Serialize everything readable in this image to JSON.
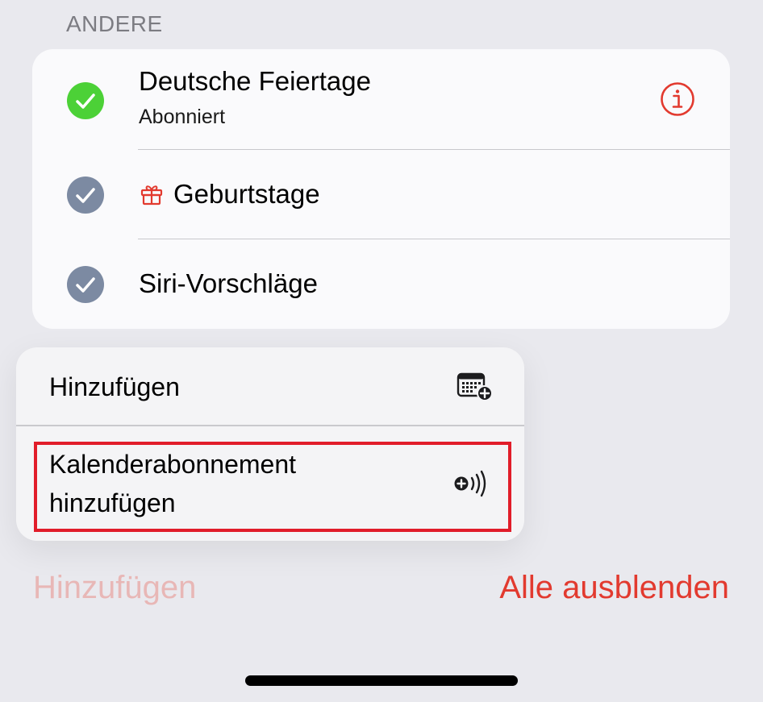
{
  "section": {
    "header": "ANDERE"
  },
  "calendars": [
    {
      "title": "Deutsche Feiertage",
      "subtitle": "Abonniert",
      "check_color": "#4cd137",
      "icon": "info-icon"
    },
    {
      "title": "Geburtstage",
      "check_color": "#7c8aa2",
      "icon": "gift-icon"
    },
    {
      "title": "Siri-Vorschläge",
      "check_color": "#7c8aa2"
    }
  ],
  "menu": {
    "items": [
      {
        "label": "Hinzufügen",
        "icon": "calendar-add-icon"
      },
      {
        "label": "Kalenderabonnement hinzufügen",
        "icon": "subscription-add-icon"
      }
    ]
  },
  "footer": {
    "add_label": "Hinzufügen",
    "hide_all_label": "Alle ausblenden"
  },
  "colors": {
    "accent": "#e23a2f",
    "accent_disabled": "#e8b7b6",
    "highlight": "#e11d2a"
  }
}
